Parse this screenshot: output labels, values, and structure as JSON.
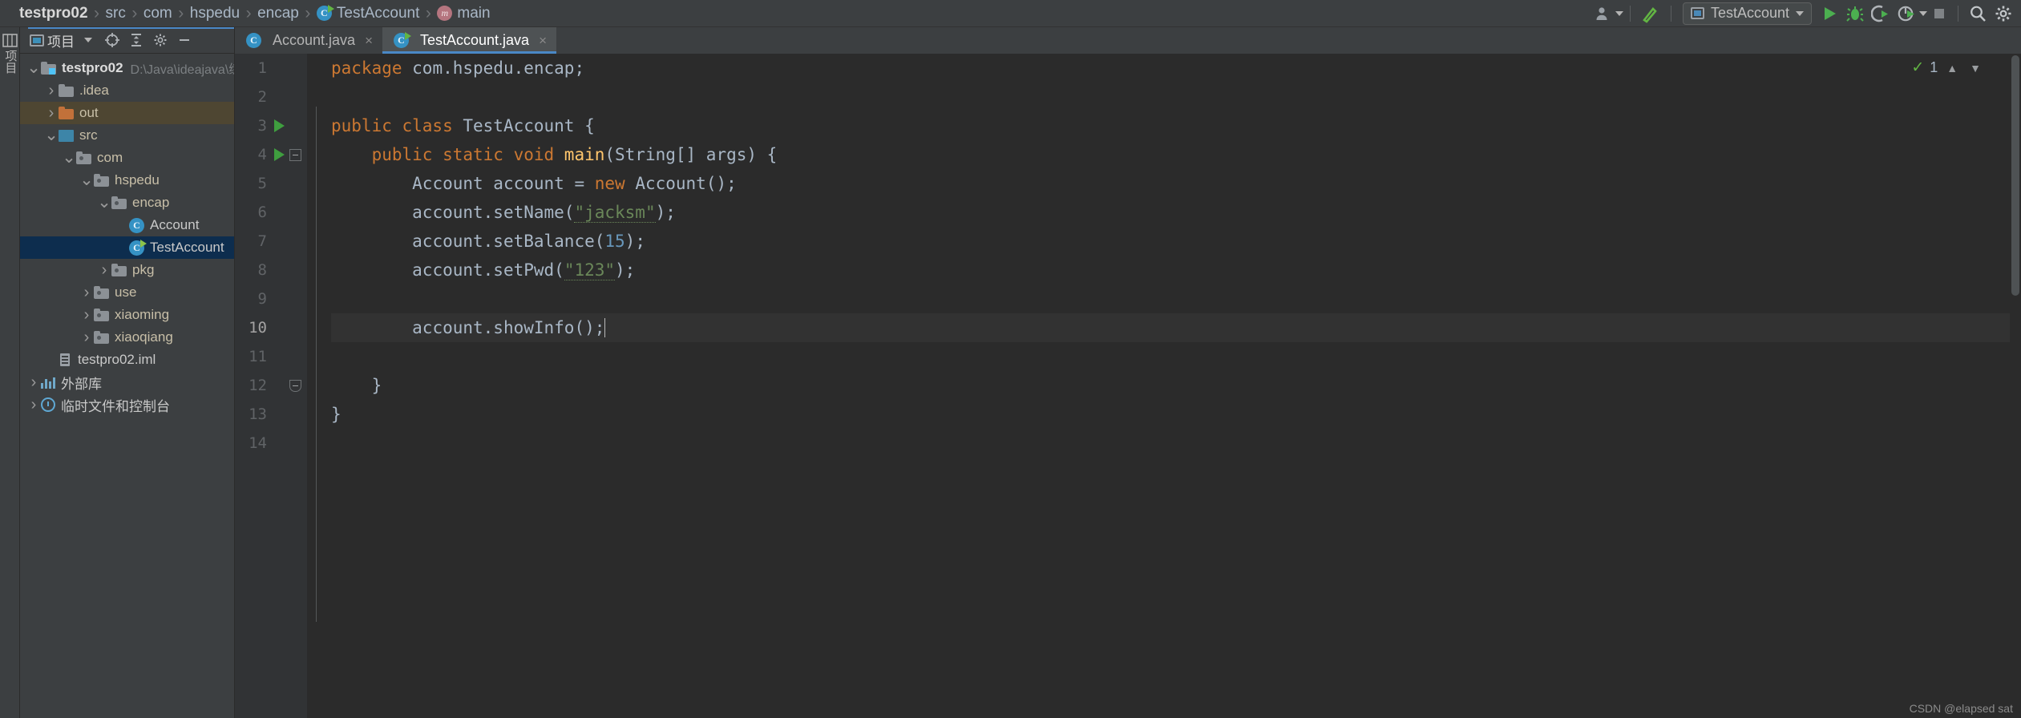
{
  "breadcrumb": {
    "items": [
      {
        "label": "testpro02",
        "icon": null,
        "root": true
      },
      {
        "label": "src",
        "icon": null
      },
      {
        "label": "com",
        "icon": null
      },
      {
        "label": "hspedu",
        "icon": null
      },
      {
        "label": "encap",
        "icon": null
      },
      {
        "label": "TestAccount",
        "icon": "class-icon"
      },
      {
        "label": "main",
        "icon": "method-icon"
      }
    ]
  },
  "toolbar": {
    "profile_icon": "user-icon",
    "build_icon": "hammer-icon",
    "run_config": "TestAccount",
    "run_icon": "run-icon",
    "debug_icon": "debug-icon",
    "coverage_icon": "run-with-coverage-icon",
    "profiler_icon": "profiler-icon",
    "stop_icon": "stop-icon",
    "search_icon": "search-icon",
    "settings_icon": "gear-icon"
  },
  "left_strip": {
    "label": "项目"
  },
  "project_panel": {
    "title": "项目",
    "icons": [
      "locate-icon",
      "collapse-all-icon",
      "settings-icon",
      "minimize-icon"
    ],
    "tree": [
      {
        "label": "testpro02",
        "path": "D:\\Java\\ideajava\\练",
        "depth": 0,
        "twist": "down",
        "icon": "module-folder",
        "bold": true,
        "state": "normal"
      },
      {
        "label": ".idea",
        "depth": 1,
        "twist": "right",
        "icon": "folder",
        "state": "normal"
      },
      {
        "label": "out",
        "depth": 1,
        "twist": "right",
        "icon": "folder-orange",
        "state": "brown"
      },
      {
        "label": "src",
        "depth": 1,
        "twist": "down",
        "icon": "folder-source",
        "state": "normal"
      },
      {
        "label": "com",
        "depth": 2,
        "twist": "down",
        "icon": "package",
        "state": "normal"
      },
      {
        "label": "hspedu",
        "depth": 3,
        "twist": "down",
        "icon": "package",
        "state": "normal"
      },
      {
        "label": "encap",
        "depth": 4,
        "twist": "down",
        "icon": "package",
        "state": "normal"
      },
      {
        "label": "Account",
        "depth": 5,
        "twist": "none",
        "icon": "class",
        "state": "normal"
      },
      {
        "label": "TestAccount",
        "depth": 5,
        "twist": "none",
        "icon": "class-runnable",
        "state": "selected"
      },
      {
        "label": "pkg",
        "depth": 4,
        "twist": "right",
        "icon": "package",
        "state": "normal"
      },
      {
        "label": "use",
        "depth": 3,
        "twist": "right",
        "icon": "package",
        "state": "normal"
      },
      {
        "label": "xiaoming",
        "depth": 3,
        "twist": "right",
        "icon": "package",
        "state": "normal"
      },
      {
        "label": "xiaoqiang",
        "depth": 3,
        "twist": "right",
        "icon": "package",
        "state": "normal"
      },
      {
        "label": "testpro02.iml",
        "depth": 1,
        "twist": "none",
        "icon": "iml",
        "state": "normal"
      },
      {
        "label": "外部库",
        "depth": 0,
        "twist": "right",
        "icon": "library",
        "state": "normal"
      },
      {
        "label": "临时文件和控制台",
        "depth": 0,
        "twist": "right",
        "icon": "scratch",
        "state": "normal"
      }
    ]
  },
  "editor": {
    "tabs": [
      {
        "label": "Account.java",
        "icon": "class-icon",
        "active": false,
        "close": "×"
      },
      {
        "label": "TestAccount.java",
        "icon": "class-runnable-icon",
        "active": true,
        "close": "×"
      }
    ],
    "inspection": {
      "count": "1",
      "check_icon": "check-icon",
      "up_icon": "chevron-up-icon",
      "down_icon": "chevron-down-icon"
    },
    "watermark": "CSDN @elapsed sat",
    "lines": [
      {
        "n": "1",
        "gutter_run": false,
        "fold": null,
        "current": false,
        "tokens": [
          {
            "t": "package ",
            "c": "kw"
          },
          {
            "t": "com.hspedu.encap;",
            "c": "id"
          }
        ],
        "indent": 0
      },
      {
        "n": "2",
        "gutter_run": false,
        "fold": null,
        "current": false,
        "tokens": [],
        "indent": 0
      },
      {
        "n": "3",
        "gutter_run": true,
        "fold": null,
        "current": false,
        "tokens": [
          {
            "t": "public class ",
            "c": "kw"
          },
          {
            "t": "TestAccount ",
            "c": "id"
          },
          {
            "t": "{",
            "c": "id"
          }
        ],
        "indent": 0
      },
      {
        "n": "4",
        "gutter_run": true,
        "fold": "top",
        "current": false,
        "tokens": [
          {
            "t": "public static void ",
            "c": "kw"
          },
          {
            "t": "main",
            "c": "fn"
          },
          {
            "t": "(String[] args) {",
            "c": "id"
          }
        ],
        "indent": 1
      },
      {
        "n": "5",
        "gutter_run": false,
        "fold": null,
        "current": false,
        "tokens": [
          {
            "t": "Account account = ",
            "c": "id"
          },
          {
            "t": "new ",
            "c": "kw"
          },
          {
            "t": "Account();",
            "c": "id"
          }
        ],
        "indent": 2
      },
      {
        "n": "6",
        "gutter_run": false,
        "fold": null,
        "current": false,
        "tokens": [
          {
            "t": "account.setName(",
            "c": "id"
          },
          {
            "t": "\"jacksm\"",
            "c": "str"
          },
          {
            "t": ");",
            "c": "id"
          }
        ],
        "indent": 2
      },
      {
        "n": "7",
        "gutter_run": false,
        "fold": null,
        "current": false,
        "tokens": [
          {
            "t": "account.setBalance(",
            "c": "id"
          },
          {
            "t": "15",
            "c": "num"
          },
          {
            "t": ");",
            "c": "id"
          }
        ],
        "indent": 2
      },
      {
        "n": "8",
        "gutter_run": false,
        "fold": null,
        "current": false,
        "tokens": [
          {
            "t": "account.setPwd(",
            "c": "id"
          },
          {
            "t": "\"123\"",
            "c": "str"
          },
          {
            "t": ");",
            "c": "id"
          }
        ],
        "indent": 2
      },
      {
        "n": "9",
        "gutter_run": false,
        "fold": null,
        "current": false,
        "tokens": [],
        "indent": 0
      },
      {
        "n": "10",
        "gutter_run": false,
        "fold": null,
        "current": true,
        "tokens": [
          {
            "t": "account.showInfo();",
            "c": "id"
          },
          {
            "t": "|",
            "c": "caret"
          }
        ],
        "indent": 2
      },
      {
        "n": "11",
        "gutter_run": false,
        "fold": null,
        "current": false,
        "tokens": [],
        "indent": 0
      },
      {
        "n": "12",
        "gutter_run": false,
        "fold": "bottom",
        "current": false,
        "tokens": [
          {
            "t": "}",
            "c": "id"
          }
        ],
        "indent": 1
      },
      {
        "n": "13",
        "gutter_run": false,
        "fold": null,
        "current": false,
        "tokens": [
          {
            "t": "}",
            "c": "id"
          }
        ],
        "indent": 0
      },
      {
        "n": "14",
        "gutter_run": false,
        "fold": null,
        "current": false,
        "tokens": [],
        "indent": 0
      }
    ]
  }
}
